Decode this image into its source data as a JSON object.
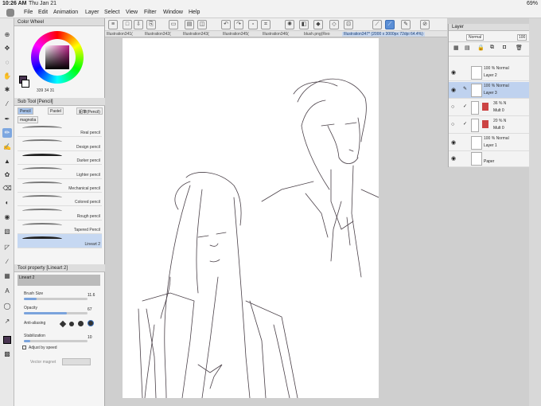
{
  "status": {
    "time": "10:26 AM",
    "date": "Thu Jan 21",
    "battery": "69%"
  },
  "menu": [
    "File",
    "Edit",
    "Animation",
    "Layer",
    "Select",
    "View",
    "Filter",
    "Window",
    "Help"
  ],
  "toolbar_icons": [
    "menu-icon",
    "new-icon",
    "save-icon",
    "undo-icon",
    "redo-icon",
    "clear-icon",
    "fill-icon",
    "snap-icon",
    "ruler-icon",
    "pen-icon",
    "transform-icon"
  ],
  "canvas_tabs": [
    "Illustration341(",
    "Illustration342(",
    "Illustration343(",
    "Illustration345(",
    "Illustration346(",
    "blush.png(Reo",
    "Illustration347* (2000 x 3000px 72dpi 64.4%)"
  ],
  "color_panel": {
    "title": "Color Wheel",
    "values": [
      "339",
      "34",
      "31"
    ],
    "fg": "#4a3552",
    "bg": "#ffffff"
  },
  "subtool": {
    "title": "Sub Tool [Pencil]",
    "tabs": [
      "Pencil",
      "Pastel",
      "鉛筆(Pencil)",
      "magnolia"
    ],
    "brushes": [
      "Real pencil",
      "Design pencil",
      "Darker pencil",
      "Lighter pencil",
      "Mechanical pencil",
      "Colored pencil",
      "Rough pencil",
      "Tapered Pencil",
      "Lineart 2"
    ]
  },
  "tool_property": {
    "title": "Tool property [Lineart 2]",
    "brush_name": "Lineart 2",
    "brush_size_label": "Brush Size",
    "brush_size": "11.6",
    "opacity_label": "Opacity",
    "opacity": "67",
    "antialias_label": "Anti-aliasing",
    "stabilization_label": "Stabilization",
    "stabilization": "10",
    "adjust_label": "Adjust by speed",
    "vector_label": "Vector magnet"
  },
  "layer_panel": {
    "title": "Layer",
    "blend": "Normal",
    "opacity": "100",
    "layers": [
      {
        "mode": "100 % Normal",
        "name": "Layer 2"
      },
      {
        "mode": "100 % Normal",
        "name": "Layer 3"
      },
      {
        "mode": "36 % N",
        "name": "Mult 0"
      },
      {
        "mode": "20 % N",
        "name": "Mult 0"
      },
      {
        "mode": "100 % Normal",
        "name": "Layer 1"
      },
      {
        "mode": "",
        "name": "Paper"
      }
    ]
  }
}
